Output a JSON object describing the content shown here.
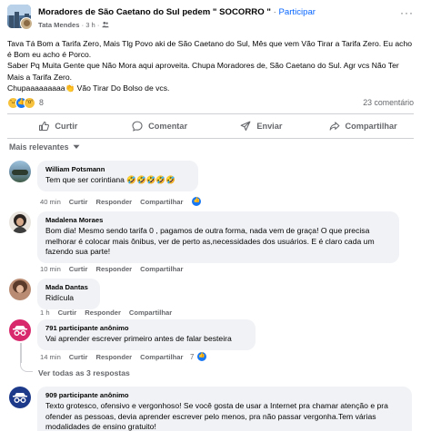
{
  "post": {
    "group_name": "Moradores de São Caetano do Sul pedem \" SOCORRO \"",
    "separator": "·",
    "participate_label": "Participar",
    "poster_name": "Tata Mendes",
    "time": "3 h",
    "more_label": "···",
    "text_lines": [
      "Tava Tá Bom a Tarifa Zero,  Mais Tlg Povo aki de São Caetano do Sul, Mês que vem Vão Tirar a Tarifa Zero. Eu acho é Bom eu acho é Porco.",
      "Saber Pq Muita Gente que Não Mora aqui aproveita. Chupa Moradores de, São Caetano do Sul. Agr vcs Não Ter Mais a Tarifa Zero.",
      "Chupaaaaaaaaa👏 Vão Tirar Do Bolso de vcs."
    ],
    "reaction_count": "8",
    "comment_count": "23 comentário"
  },
  "actions": {
    "like": "Curtir",
    "comment": "Comentar",
    "send": "Enviar",
    "share": "Compartilhar"
  },
  "sort_label": "Mais relevantes",
  "comments": [
    {
      "name": "William Potsmann",
      "text": "Tem que ser corintiana 🤣🤣🤣🤣🤣",
      "time": "40 min",
      "like": "Curtir",
      "reply": "Responder",
      "share": "Compartilhar"
    },
    {
      "name": "Madalena Moraes",
      "text": "Bom dia! Mesmo sendo tarifa 0 , pagamos de outra forma, nada vem de graça! O que precisa melhorar é colocar mais ônibus, ver de perto as,necessidades dos usuários. E é claro cada um fazendo sua parte!",
      "time": "10 min",
      "like": "Curtir",
      "reply": "Responder",
      "share": "Compartilhar"
    },
    {
      "name": "Mada Dantas",
      "text": "Ridícula",
      "time": "1 h",
      "like": "Curtir",
      "reply": "Responder",
      "share": "Compartilhar"
    },
    {
      "name": "791 participante anônimo",
      "text": "Vai aprender escrever primeiro antes de falar besteira",
      "time": "14 min",
      "like": "Curtir",
      "reply": "Responder",
      "share": "Compartilhar",
      "like_count": "7"
    },
    {
      "name": "909 participante anônimo",
      "text": "Texto grotesco, ofensivo e vergonhoso! Se você gosta de usar a Internet pra chamar atenção e pra ofender as pessoas, devia aprender escrever pelo menos, pra não passar vergonha.Tem várias modalidades de ensino gratuito!"
    }
  ],
  "view_replies_label": "Ver todas as 3 respostas",
  "colors": {
    "accent": "#0866ff",
    "like_blue": "#1877f2",
    "muted_text": "#65676b",
    "bubble_bg": "#f0f2f5",
    "anon_pink": "#d8296d",
    "anon_navy": "#1d3a8a"
  }
}
